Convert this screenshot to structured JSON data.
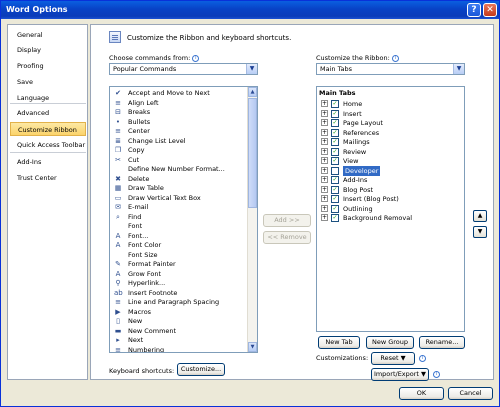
{
  "window": {
    "title": "Word Options",
    "help_glyph": "?",
    "close_glyph": "✕"
  },
  "nav": {
    "items": [
      {
        "label": "General",
        "selected": false
      },
      {
        "label": "Display",
        "selected": false
      },
      {
        "label": "Proofing",
        "selected": false
      },
      {
        "label": "Save",
        "selected": false
      },
      {
        "label": "Language",
        "selected": false
      },
      {
        "label": "Advanced",
        "selected": false
      },
      {
        "label": "Customize Ribbon",
        "selected": true
      },
      {
        "label": "Quick Access Toolbar",
        "selected": false
      },
      {
        "label": "Add-Ins",
        "selected": false
      },
      {
        "label": "Trust Center",
        "selected": false
      }
    ]
  },
  "main": {
    "heading": "Customize the Ribbon and keyboard shortcuts.",
    "choose_commands_label": "Choose commands from:",
    "choose_commands_value": "Popular Commands",
    "customize_ribbon_label": "Customize the Ribbon:",
    "customize_ribbon_value": "Main Tabs",
    "commands": [
      {
        "label": "Accept and Move to Next",
        "icon": "✔",
        "arrow": false,
        "marker": ""
      },
      {
        "label": "Align Left",
        "icon": "≡",
        "arrow": false,
        "marker": ""
      },
      {
        "label": "Breaks",
        "icon": "⊟",
        "arrow": true,
        "marker": ""
      },
      {
        "label": "Bullets",
        "icon": "•",
        "arrow": true,
        "marker": ""
      },
      {
        "label": "Center",
        "icon": "≡",
        "arrow": false,
        "marker": ""
      },
      {
        "label": "Change List Level",
        "icon": "≣",
        "arrow": true,
        "marker": ""
      },
      {
        "label": "Copy",
        "icon": "❐",
        "arrow": false,
        "marker": ""
      },
      {
        "label": "Cut",
        "icon": "✂",
        "arrow": false,
        "marker": ""
      },
      {
        "label": "Define New Number Format...",
        "icon": "",
        "arrow": false,
        "marker": ""
      },
      {
        "label": "Delete",
        "icon": "✖",
        "arrow": false,
        "marker": ""
      },
      {
        "label": "Draw Table",
        "icon": "▦",
        "arrow": false,
        "marker": ""
      },
      {
        "label": "Draw Vertical Text Box",
        "icon": "▭",
        "arrow": false,
        "marker": ""
      },
      {
        "label": "E-mail",
        "icon": "✉",
        "arrow": false,
        "marker": ""
      },
      {
        "label": "Find",
        "icon": "⌕",
        "arrow": false,
        "marker": ""
      },
      {
        "label": "Font",
        "icon": "",
        "arrow": false,
        "marker": "I·"
      },
      {
        "label": "Font...",
        "icon": "A",
        "arrow": false,
        "marker": ""
      },
      {
        "label": "Font Color",
        "icon": "A",
        "arrow": true,
        "marker": ""
      },
      {
        "label": "Font Size",
        "icon": "",
        "arrow": false,
        "marker": "I·"
      },
      {
        "label": "Format Painter",
        "icon": "✎",
        "arrow": false,
        "marker": ""
      },
      {
        "label": "Grow Font",
        "icon": "A",
        "arrow": false,
        "marker": ""
      },
      {
        "label": "Hyperlink...",
        "icon": "⚲",
        "arrow": false,
        "marker": ""
      },
      {
        "label": "Insert Footnote",
        "icon": "ab",
        "arrow": false,
        "marker": ""
      },
      {
        "label": "Line and Paragraph Spacing",
        "icon": "≡",
        "arrow": true,
        "marker": ""
      },
      {
        "label": "Macros",
        "icon": "▶",
        "arrow": false,
        "marker": ""
      },
      {
        "label": "New",
        "icon": "▯",
        "arrow": false,
        "marker": ""
      },
      {
        "label": "New Comment",
        "icon": "▬",
        "arrow": false,
        "marker": ""
      },
      {
        "label": "Next",
        "icon": "▸",
        "arrow": false,
        "marker": ""
      },
      {
        "label": "Numbering",
        "icon": "≡",
        "arrow": true,
        "marker": ""
      }
    ],
    "add_button": "Add >>",
    "remove_button": "<< Remove",
    "tabs_header": "Main Tabs",
    "tabs": [
      {
        "label": "Home",
        "checked": true,
        "selected": false
      },
      {
        "label": "Insert",
        "checked": true,
        "selected": false
      },
      {
        "label": "Page Layout",
        "checked": true,
        "selected": false
      },
      {
        "label": "References",
        "checked": true,
        "selected": false
      },
      {
        "label": "Mailings",
        "checked": true,
        "selected": false
      },
      {
        "label": "Review",
        "checked": true,
        "selected": false
      },
      {
        "label": "View",
        "checked": true,
        "selected": false
      },
      {
        "label": "Developer",
        "checked": false,
        "selected": true
      },
      {
        "label": "Add-Ins",
        "checked": true,
        "selected": false
      },
      {
        "label": "Blog Post",
        "checked": true,
        "selected": false
      },
      {
        "label": "Insert (Blog Post)",
        "checked": true,
        "selected": false
      },
      {
        "label": "Outlining",
        "checked": true,
        "selected": false
      },
      {
        "label": "Background Removal",
        "checked": true,
        "selected": false
      }
    ],
    "new_tab_button": "New Tab",
    "new_group_button": "New Group",
    "rename_button": "Rename...",
    "customizations_label": "Customizations:",
    "reset_button": "Reset ▼",
    "import_export_button": "Import/Export ▼",
    "keyboard_shortcuts_label": "Keyboard shortcuts:",
    "customize_button": "Customize...",
    "move_up_glyph": "▲",
    "move_down_glyph": "▼"
  },
  "footer": {
    "ok_button": "OK",
    "cancel_button": "Cancel"
  }
}
